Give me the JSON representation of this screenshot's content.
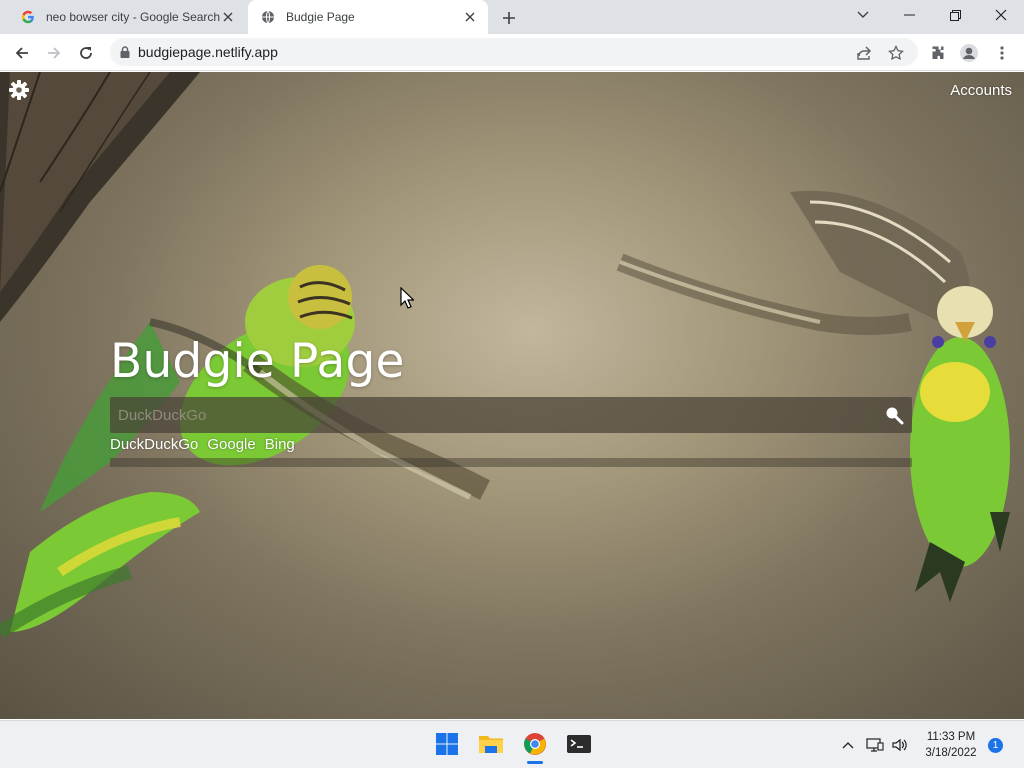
{
  "browser": {
    "tabs": [
      {
        "title": "neo bowser city - Google Search",
        "active": false
      },
      {
        "title": "Budgie Page",
        "active": true
      }
    ],
    "url": "budgiepage.netlify.app"
  },
  "page": {
    "accounts_label": "Accounts",
    "heading": "Budgie Page",
    "search_placeholder": "DuckDuckGo",
    "engines": [
      "DuckDuckGo",
      "Google",
      "Bing"
    ]
  },
  "taskbar": {
    "time": "11:33 PM",
    "date": "3/18/2022",
    "notification_count": "1"
  },
  "colors": {
    "accent": "#1a73e8",
    "search_bar": "#484237",
    "budgie_green": "#7bc934",
    "budgie_yellow": "#e6dc3a"
  }
}
